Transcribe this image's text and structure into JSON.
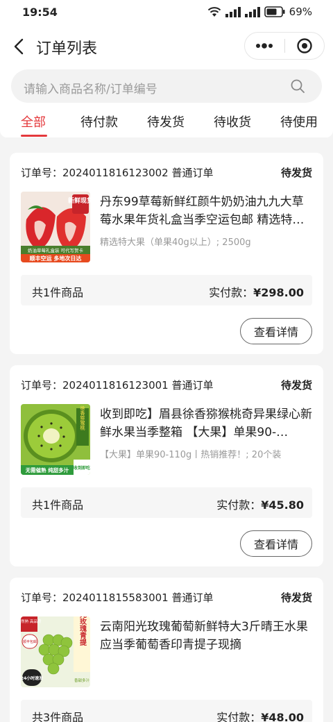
{
  "status_bar": {
    "time": "19:54",
    "battery": "69%"
  },
  "nav": {
    "title": "订单列表"
  },
  "search": {
    "placeholder": "请输入商品名称/订单编号"
  },
  "tabs": [
    {
      "label": "全部",
      "active": true
    },
    {
      "label": "待付款",
      "active": false
    },
    {
      "label": "待发货",
      "active": false
    },
    {
      "label": "待收货",
      "active": false
    },
    {
      "label": "待使用",
      "active": false
    }
  ],
  "orders": [
    {
      "order_no": "订单号：2024011816123002 普通订单",
      "status": "待发货",
      "title": "丹东99草莓新鲜红颜牛奶奶油九九大草莓水果年货礼盒当季空运包邮 精选特…",
      "spec": "精选特大果（单果40g以上）; 2500g",
      "count": "共1件商品",
      "paid_label": "实付款：",
      "amount": "¥298.00",
      "detail_label": "查看详情",
      "thumb_texts": [
        "新鲜现货",
        "奶油草莓礼盒装 可代写贺卡",
        "顺丰空运 多地次日达"
      ]
    },
    {
      "order_no": "订单号：2024011816123001 普通订单",
      "status": "待发货",
      "title": "收到即吃】眉县徐香猕猴桃奇异果绿心新鲜水果当季整箱 【大果】单果90-…",
      "spec": "【大果】单果90-110g丨热销推荐！; 20个装",
      "count": "共1件商品",
      "paid_label": "实付款：",
      "amount": "¥45.80",
      "detail_label": "查看详情",
      "thumb_texts": [
        "徐香猕猴桃",
        "无需催熟 纯甜多汁",
        "收到即吃"
      ]
    },
    {
      "order_no": "订单号：2024011815583001 普通订单",
      "status": "待发货",
      "title": "云南阳光玫瑰葡萄新鲜特大3斤晴王水果应当季葡萄香印青提子现摘",
      "spec": "",
      "count": "共3件商品",
      "paid_label": "实付款：",
      "amount": "¥48.00",
      "detail_label": "查看详情",
      "thumb_texts": [
        "自然熟 高品质",
        "顺丰包邮",
        "阳光玫瑰青提",
        "24小时速发",
        "香甜多汁"
      ]
    }
  ],
  "colors": {
    "accent": "#e4393c",
    "background": "#f4f4f4"
  }
}
